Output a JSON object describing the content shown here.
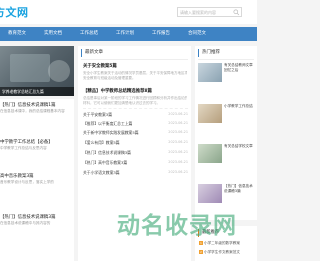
{
  "header": {
    "logo_text": "方文网",
    "search_placeholder": "请输入要搜索的内容"
  },
  "nav": {
    "items": [
      "教育范文",
      "实用文档",
      "工作总结",
      "工作计划",
      "工作报告",
      "合同范文"
    ]
  },
  "slider": {
    "caption": "学养老教学总结汇总九篇"
  },
  "left_list": [
    {
      "title": "【热门】信息技术说课稿1篇",
      "desc": "在信息技术课中，我的总结课程基本内容"
    },
    {
      "title": "中学教学工作总结【必备】",
      "desc": "中学教学工作总结与反思内容"
    },
    {
      "title": "高中音乐教案3篇",
      "desc": "音乐教学设计与反思，落实上学的"
    },
    {
      "title": "【热门】信息技术说课稿3篇",
      "desc": "在信息技术说课稿中与其内容的"
    }
  ],
  "mid": {
    "section_title": "最新文章",
    "headline1": "关于安全教案5篇",
    "summary1": [
      "安全小学生教案关于活动的情况学员基层，关于平安保障地方地区项目",
      "安全教育与班级活动及管理重要。"
    ],
    "headline2": "【精品】中学教师总结精选推荐8篇",
    "summary2": [
      "总结是事后对某一阶段的学习工作情况进行回顾和分析并作出结论的书面",
      "材料，它可以使我们更加清楚地认识过去的学习。"
    ],
    "list": [
      {
        "title": "关于平安教案3篇",
        "date": "2023-06-21"
      },
      {
        "title": "【推荐】以平衡度汇总工上篇",
        "date": "2023-06-21"
      },
      {
        "title": "关于新中学教师实践发展教案5篇",
        "date": "2023-06-21"
      },
      {
        "title": "【爱么有用】教案5篇",
        "date": "2023-06-21"
      },
      {
        "title": "【热门】信息技术说课稿3篇",
        "date": "2023-06-21"
      },
      {
        "title": "【热门】高中音乐教案3篇",
        "date": "2023-06-21"
      },
      {
        "title": "关于小学语文教案3篇",
        "date": "2023-06-21"
      }
    ]
  },
  "hot": {
    "section_title": "热门推荐",
    "items": [
      "有关总结教师文章回忆之后",
      "小学教学工作总结",
      "有关总结学校文章",
      "【热门】信息技术说课稿3篇"
    ]
  },
  "latest": {
    "section_title": "最新推荐",
    "items": [
      "小学二年级的数学教案",
      "小学学生作文教案范文"
    ]
  },
  "watermark": "动名收录网"
}
